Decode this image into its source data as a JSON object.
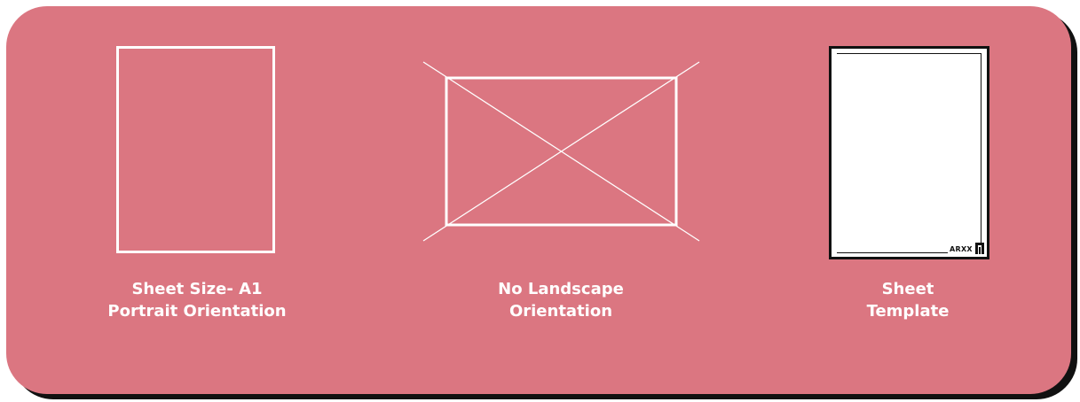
{
  "colors": {
    "card_background": "#db7681",
    "card_shadow": "#111111",
    "line": "#ffffff",
    "template_paper": "#ffffff",
    "template_ink": "#111111"
  },
  "items": [
    {
      "icon": "portrait-sheet-icon",
      "caption_lines": [
        "Sheet Size- A1",
        "Portrait Orientation"
      ]
    },
    {
      "icon": "crossed-landscape-sheet-icon",
      "caption_lines": [
        "No Landscape",
        "Orientation"
      ]
    },
    {
      "icon": "sheet-template-icon",
      "template_label": "ARXX",
      "caption_lines": [
        "Sheet",
        "Template"
      ]
    }
  ]
}
